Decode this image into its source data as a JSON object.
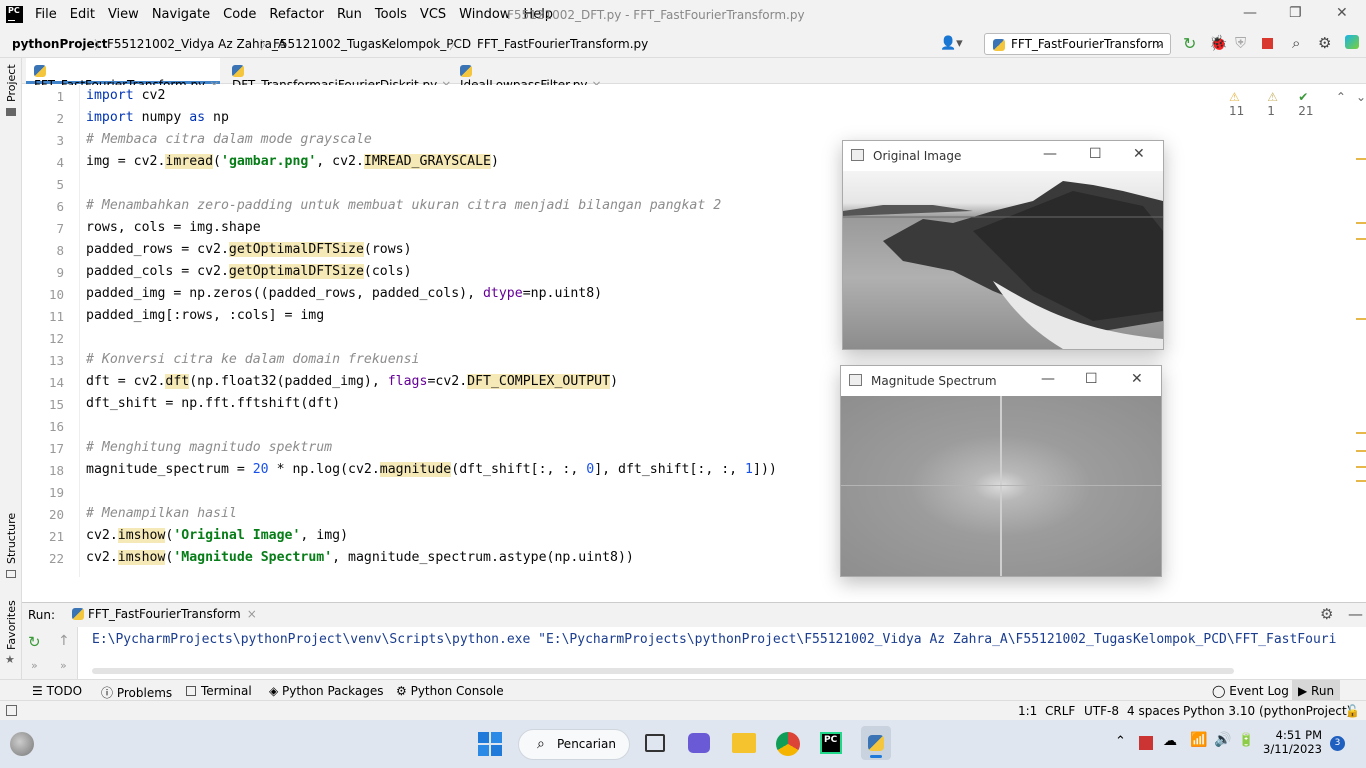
{
  "titlebar": {
    "menu": [
      "File",
      "Edit",
      "View",
      "Navigate",
      "Code",
      "Refactor",
      "Run",
      "Tools",
      "VCS",
      "Window",
      "Help"
    ],
    "window_title": "F55121002_DFT.py - FFT_FastFourierTransform.py"
  },
  "navbar": {
    "crumbs": [
      "pythonProject",
      "F55121002_Vidya Az Zahra_A",
      "F55121002_TugasKelompok_PCD",
      "FFT_FastFourierTransform.py"
    ],
    "run_config": "FFT_FastFourierTransform"
  },
  "sidebar": {
    "project": "Project",
    "structure": "Structure",
    "favorites": "Favorites"
  },
  "tabs": [
    "FFT_FastFourierTransform.py",
    "DFT_TransformasiFourierDiskrit.py",
    "IdealLowpassFilter.py"
  ],
  "inspections": {
    "warnings": "11",
    "weak": "1",
    "ok": "21"
  },
  "code": {
    "line_numbers": [
      "1",
      "2",
      "3",
      "4",
      "5",
      "6",
      "7",
      "8",
      "9",
      "10",
      "11",
      "12",
      "13",
      "14",
      "15",
      "16",
      "17",
      "18",
      "19",
      "20",
      "21",
      "22"
    ],
    "l1_kw": "import",
    "l1_rest": " cv2",
    "l2_kw": "import",
    "l2_mid": " numpy ",
    "l2_kw2": "as",
    "l2_rest": " np",
    "l3": "# Membaca citra dalam mode grayscale",
    "l4_a": "img = cv2.",
    "l4_fn": "imread",
    "l4_b": "(",
    "l4_str": "'gambar.png'",
    "l4_c": ", cv2.",
    "l4_const": "IMREAD_GRAYSCALE",
    "l4_d": ")",
    "l6": "# Menambahkan zero-padding untuk membuat ukuran citra menjadi bilangan pangkat 2",
    "l7": "rows, cols = img.shape",
    "l8_a": "padded_rows = cv2.",
    "l8_fn": "getOptimalDFTSize",
    "l8_b": "(rows)",
    "l9_a": "padded_cols = cv2.",
    "l9_fn": "getOptimalDFTSize",
    "l9_b": "(cols)",
    "l10_a": "padded_img = np.zeros((padded_rows, padded_cols), ",
    "l10_kw": "dtype",
    "l10_b": "=np.uint8)",
    "l11": "padded_img[:rows, :cols] = img",
    "l13": "# Konversi citra ke dalam domain frekuensi",
    "l14_a": "dft = cv2.",
    "l14_fn": "dft",
    "l14_b": "(np.float32(padded_img), ",
    "l14_kw": "flags",
    "l14_c": "=cv2.",
    "l14_const": "DFT_COMPLEX_OUTPUT",
    "l14_d": ")",
    "l15": "dft_shift = np.fft.fftshift(dft)",
    "l17": "# Menghitung magnitudo spektrum",
    "l18_a": "magnitude_spectrum = ",
    "l18_n1": "20",
    "l18_b": " * np.log(cv2.",
    "l18_fn": "magnitude",
    "l18_c": "(dft_shift[:, :, ",
    "l18_n2": "0",
    "l18_d": "], dft_shift[:, :, ",
    "l18_n3": "1",
    "l18_e": "]))",
    "l20": "# Menampilkan hasil",
    "l21_a": "cv2.",
    "l21_fn": "imshow",
    "l21_b": "(",
    "l21_str": "'Original Image'",
    "l21_c": ", img)",
    "l22_a": "cv2.",
    "l22_fn": "imshow",
    "l22_b": "(",
    "l22_str": "'Magnitude Spectrum'",
    "l22_c": ", magnitude_spectrum.astype(np.uint8))"
  },
  "windows": {
    "original": "Original Image",
    "magnitude": "Magnitude Spectrum"
  },
  "run": {
    "label": "Run:",
    "tab": "FFT_FastFourierTransform",
    "console": "E:\\PycharmProjects\\pythonProject\\venv\\Scripts\\python.exe \"E:\\PycharmProjects\\pythonProject\\F55121002_Vidya Az Zahra_A\\F55121002_TugasKelompok_PCD\\FFT_FastFouri"
  },
  "tooltabs": [
    "TODO",
    "Problems",
    "Terminal",
    "Python Packages",
    "Python Console",
    "Event Log",
    "Run"
  ],
  "status": {
    "pos": "1:1",
    "eol": "CRLF",
    "enc": "UTF-8",
    "indent": "4 spaces",
    "interp": "Python 3.10 (pythonProject)"
  },
  "taskbar": {
    "search": "Pencarian",
    "time": "4:51 PM",
    "date": "3/11/2023",
    "badge": "3"
  }
}
